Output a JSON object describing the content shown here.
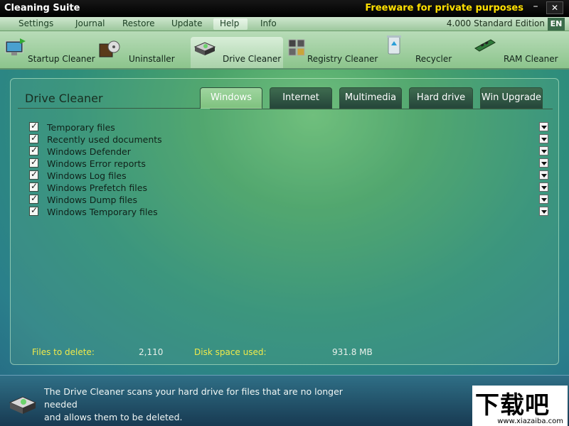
{
  "window": {
    "title": "Cleaning Suite",
    "notice": "Freeware for private purposes",
    "minimize_glyph": "–",
    "close_glyph": "✕"
  },
  "menu": {
    "items": [
      "Settings",
      "Journal",
      "Restore",
      "Update",
      "Help",
      "Info"
    ],
    "active": "Help",
    "edition": "4.000 Standard Edition",
    "language": "EN"
  },
  "toolbar": {
    "items": [
      {
        "label": "Startup Cleaner",
        "icon": "startup-cleaner-icon"
      },
      {
        "label": "Uninstaller",
        "icon": "uninstaller-icon"
      },
      {
        "label": "Drive Cleaner",
        "icon": "drive-cleaner-icon"
      },
      {
        "label": "Registry Cleaner",
        "icon": "registry-cleaner-icon"
      },
      {
        "label": "Recycler",
        "icon": "recycler-icon"
      },
      {
        "label": "RAM Cleaner",
        "icon": "ram-cleaner-icon"
      }
    ],
    "active": "Drive Cleaner"
  },
  "panel": {
    "title": "Drive Cleaner",
    "tabs": [
      "Windows",
      "Internet",
      "Multimedia",
      "Hard drive",
      "Win Upgrade"
    ],
    "active_tab": "Windows",
    "files": [
      {
        "name": "Temporary files",
        "checked": true
      },
      {
        "name": "Recently used documents",
        "checked": true
      },
      {
        "name": "Windows Defender",
        "checked": true
      },
      {
        "name": "Windows Error reports",
        "checked": true
      },
      {
        "name": "Windows Log files",
        "checked": true
      },
      {
        "name": "Windows Prefetch files",
        "checked": true
      },
      {
        "name": "Windows Dump files",
        "checked": true
      },
      {
        "name": "Windows Temporary files",
        "checked": true
      }
    ],
    "stats": {
      "files_label": "Files to delete:",
      "files_value": "2,110",
      "disk_label": "Disk space used:",
      "disk_value": "931.8 MB"
    }
  },
  "footer": {
    "description_line1": "The Drive Cleaner scans your hard drive for files that are no longer needed",
    "description_line2": "and allows them to be deleted.",
    "watermark_big": "下载吧",
    "watermark_small": "www.xiazaiba.com"
  },
  "colors": {
    "accent_yellow": "#ffe000",
    "stats_label": "#f0ea4a",
    "tab_active": "#8fcb8f",
    "tab_inactive": "#2f5443"
  }
}
